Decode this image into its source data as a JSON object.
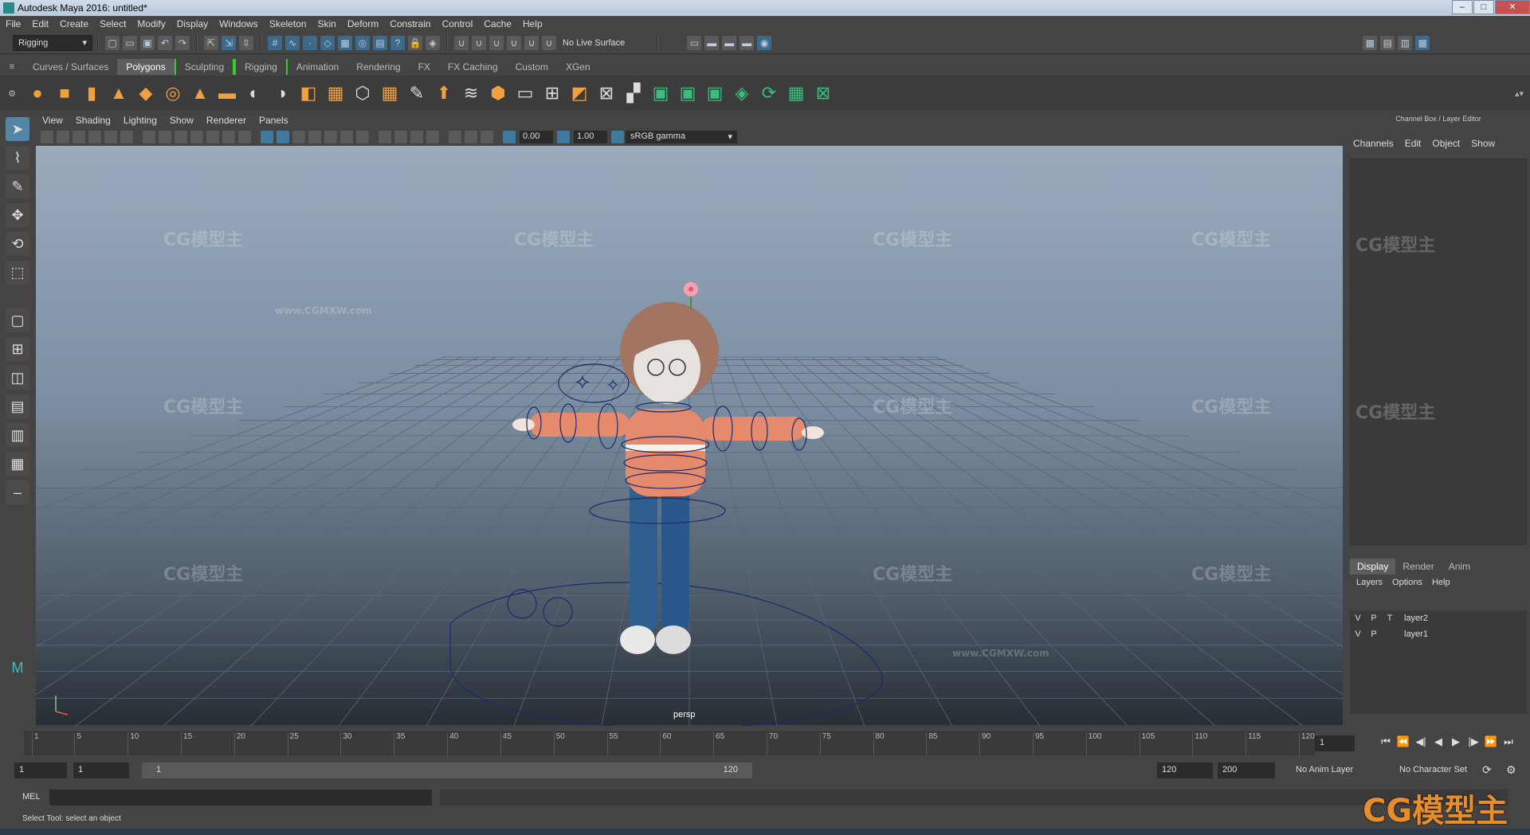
{
  "title": "Autodesk Maya 2016: untitled*",
  "window_controls": [
    "–",
    "□",
    "✕"
  ],
  "menus": [
    "File",
    "Edit",
    "Create",
    "Select",
    "Modify",
    "Display",
    "Windows",
    "Skeleton",
    "Skin",
    "Deform",
    "Constrain",
    "Control",
    "Cache",
    "Help"
  ],
  "status": {
    "menuset": "Rigging",
    "live_surface": "No Live Surface"
  },
  "shelf_tabs": [
    "Curves / Surfaces",
    "Polygons",
    "Sculpting",
    "Rigging",
    "Animation",
    "Rendering",
    "FX",
    "FX Caching",
    "Custom",
    "XGen"
  ],
  "shelf_active": "Polygons",
  "viewport": {
    "menus": [
      "View",
      "Shading",
      "Lighting",
      "Show",
      "Renderer",
      "Panels"
    ],
    "field_a": "0.00",
    "field_b": "1.00",
    "color_space": "sRGB gamma",
    "camera": "persp",
    "watermark": "CG模型主",
    "watermark_url": "www.CGMXW.com"
  },
  "right_panel": {
    "title": "Channel Box / Layer Editor",
    "menus": [
      "Channels",
      "Edit",
      "Object",
      "Show"
    ],
    "tabs": [
      "Display",
      "Render",
      "Anim"
    ],
    "tab_active": "Display",
    "sub_menus": [
      "Layers",
      "Options",
      "Help"
    ],
    "layers": [
      {
        "v": "V",
        "p": "P",
        "t": "T",
        "name": "layer2"
      },
      {
        "v": "V",
        "p": "P",
        "t": "",
        "name": "layer1"
      }
    ]
  },
  "timeline": {
    "ticks": [
      "1",
      "5",
      "10",
      "15",
      "20",
      "25",
      "30",
      "35",
      "40",
      "45",
      "50",
      "55",
      "60",
      "65",
      "70",
      "75",
      "80",
      "85",
      "90",
      "95",
      "100",
      "105",
      "110",
      "115",
      "120"
    ],
    "current_frame": "1",
    "playback": [
      "⏮",
      "⏪",
      "◀|",
      "◀",
      "▶",
      "|▶",
      "⏩",
      "⏭"
    ]
  },
  "range": {
    "start": "1",
    "anim_start": "1",
    "range_start": "1",
    "range_end": "120",
    "anim_end": "120",
    "end": "200",
    "anim_layer": "No Anim Layer",
    "char_set": "No Character Set"
  },
  "cmd": {
    "label": "MEL"
  },
  "help_text": "Select Tool: select an object",
  "big_watermark": "CG模型主"
}
